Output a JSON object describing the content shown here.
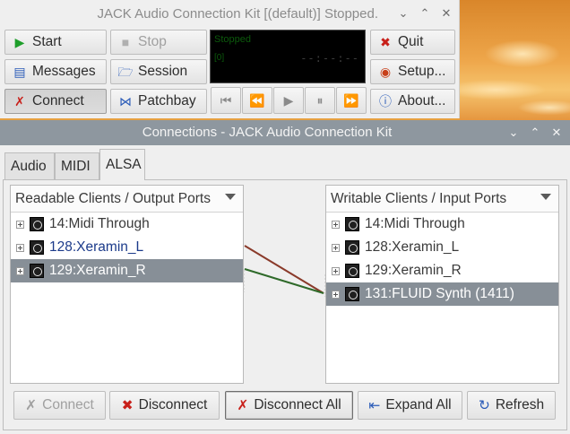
{
  "jack": {
    "title": "JACK Audio Connection Kit [(default)] Stopped.",
    "buttons": {
      "start": "Start",
      "stop": "Stop",
      "quit": "Quit",
      "messages": "Messages",
      "session": "Session",
      "setup": "Setup...",
      "connect": "Connect",
      "patchbay": "Patchbay",
      "about": "About..."
    },
    "display": {
      "status": "Stopped",
      "rate": "[0]",
      "time": "--:--:--"
    }
  },
  "connections": {
    "title": "Connections - JACK Audio Connection Kit",
    "tabs": [
      "Audio",
      "MIDI",
      "ALSA"
    ],
    "active_tab": "ALSA",
    "readable": {
      "header": "Readable Clients / Output Ports",
      "items": [
        "14:Midi Through",
        "128:Xeramin_L",
        "129:Xeramin_R"
      ],
      "selected": "129:Xeramin_R"
    },
    "writable": {
      "header": "Writable Clients / Input Ports",
      "items": [
        "14:Midi Through",
        "128:Xeramin_L",
        "129:Xeramin_R",
        "131:FLUID Synth (1411)"
      ],
      "selected": "131:FLUID Synth (1411)"
    },
    "connection_lines": [
      {
        "from": "128:Xeramin_L",
        "to": "131:FLUID Synth (1411)",
        "color": "#8a3a2a"
      },
      {
        "from": "129:Xeramin_R",
        "to": "131:FLUID Synth (1411)",
        "color": "#2f6a2a"
      }
    ],
    "buttons": {
      "connect": "Connect",
      "disconnect": "Disconnect",
      "disconnect_all": "Disconnect All",
      "expand_all": "Expand All",
      "refresh": "Refresh"
    }
  },
  "colors": {
    "selection": "#878f97",
    "titlebar_active": "#8e979f",
    "accent_start": "#1e9e2a",
    "accent_quit": "#c8201a"
  }
}
